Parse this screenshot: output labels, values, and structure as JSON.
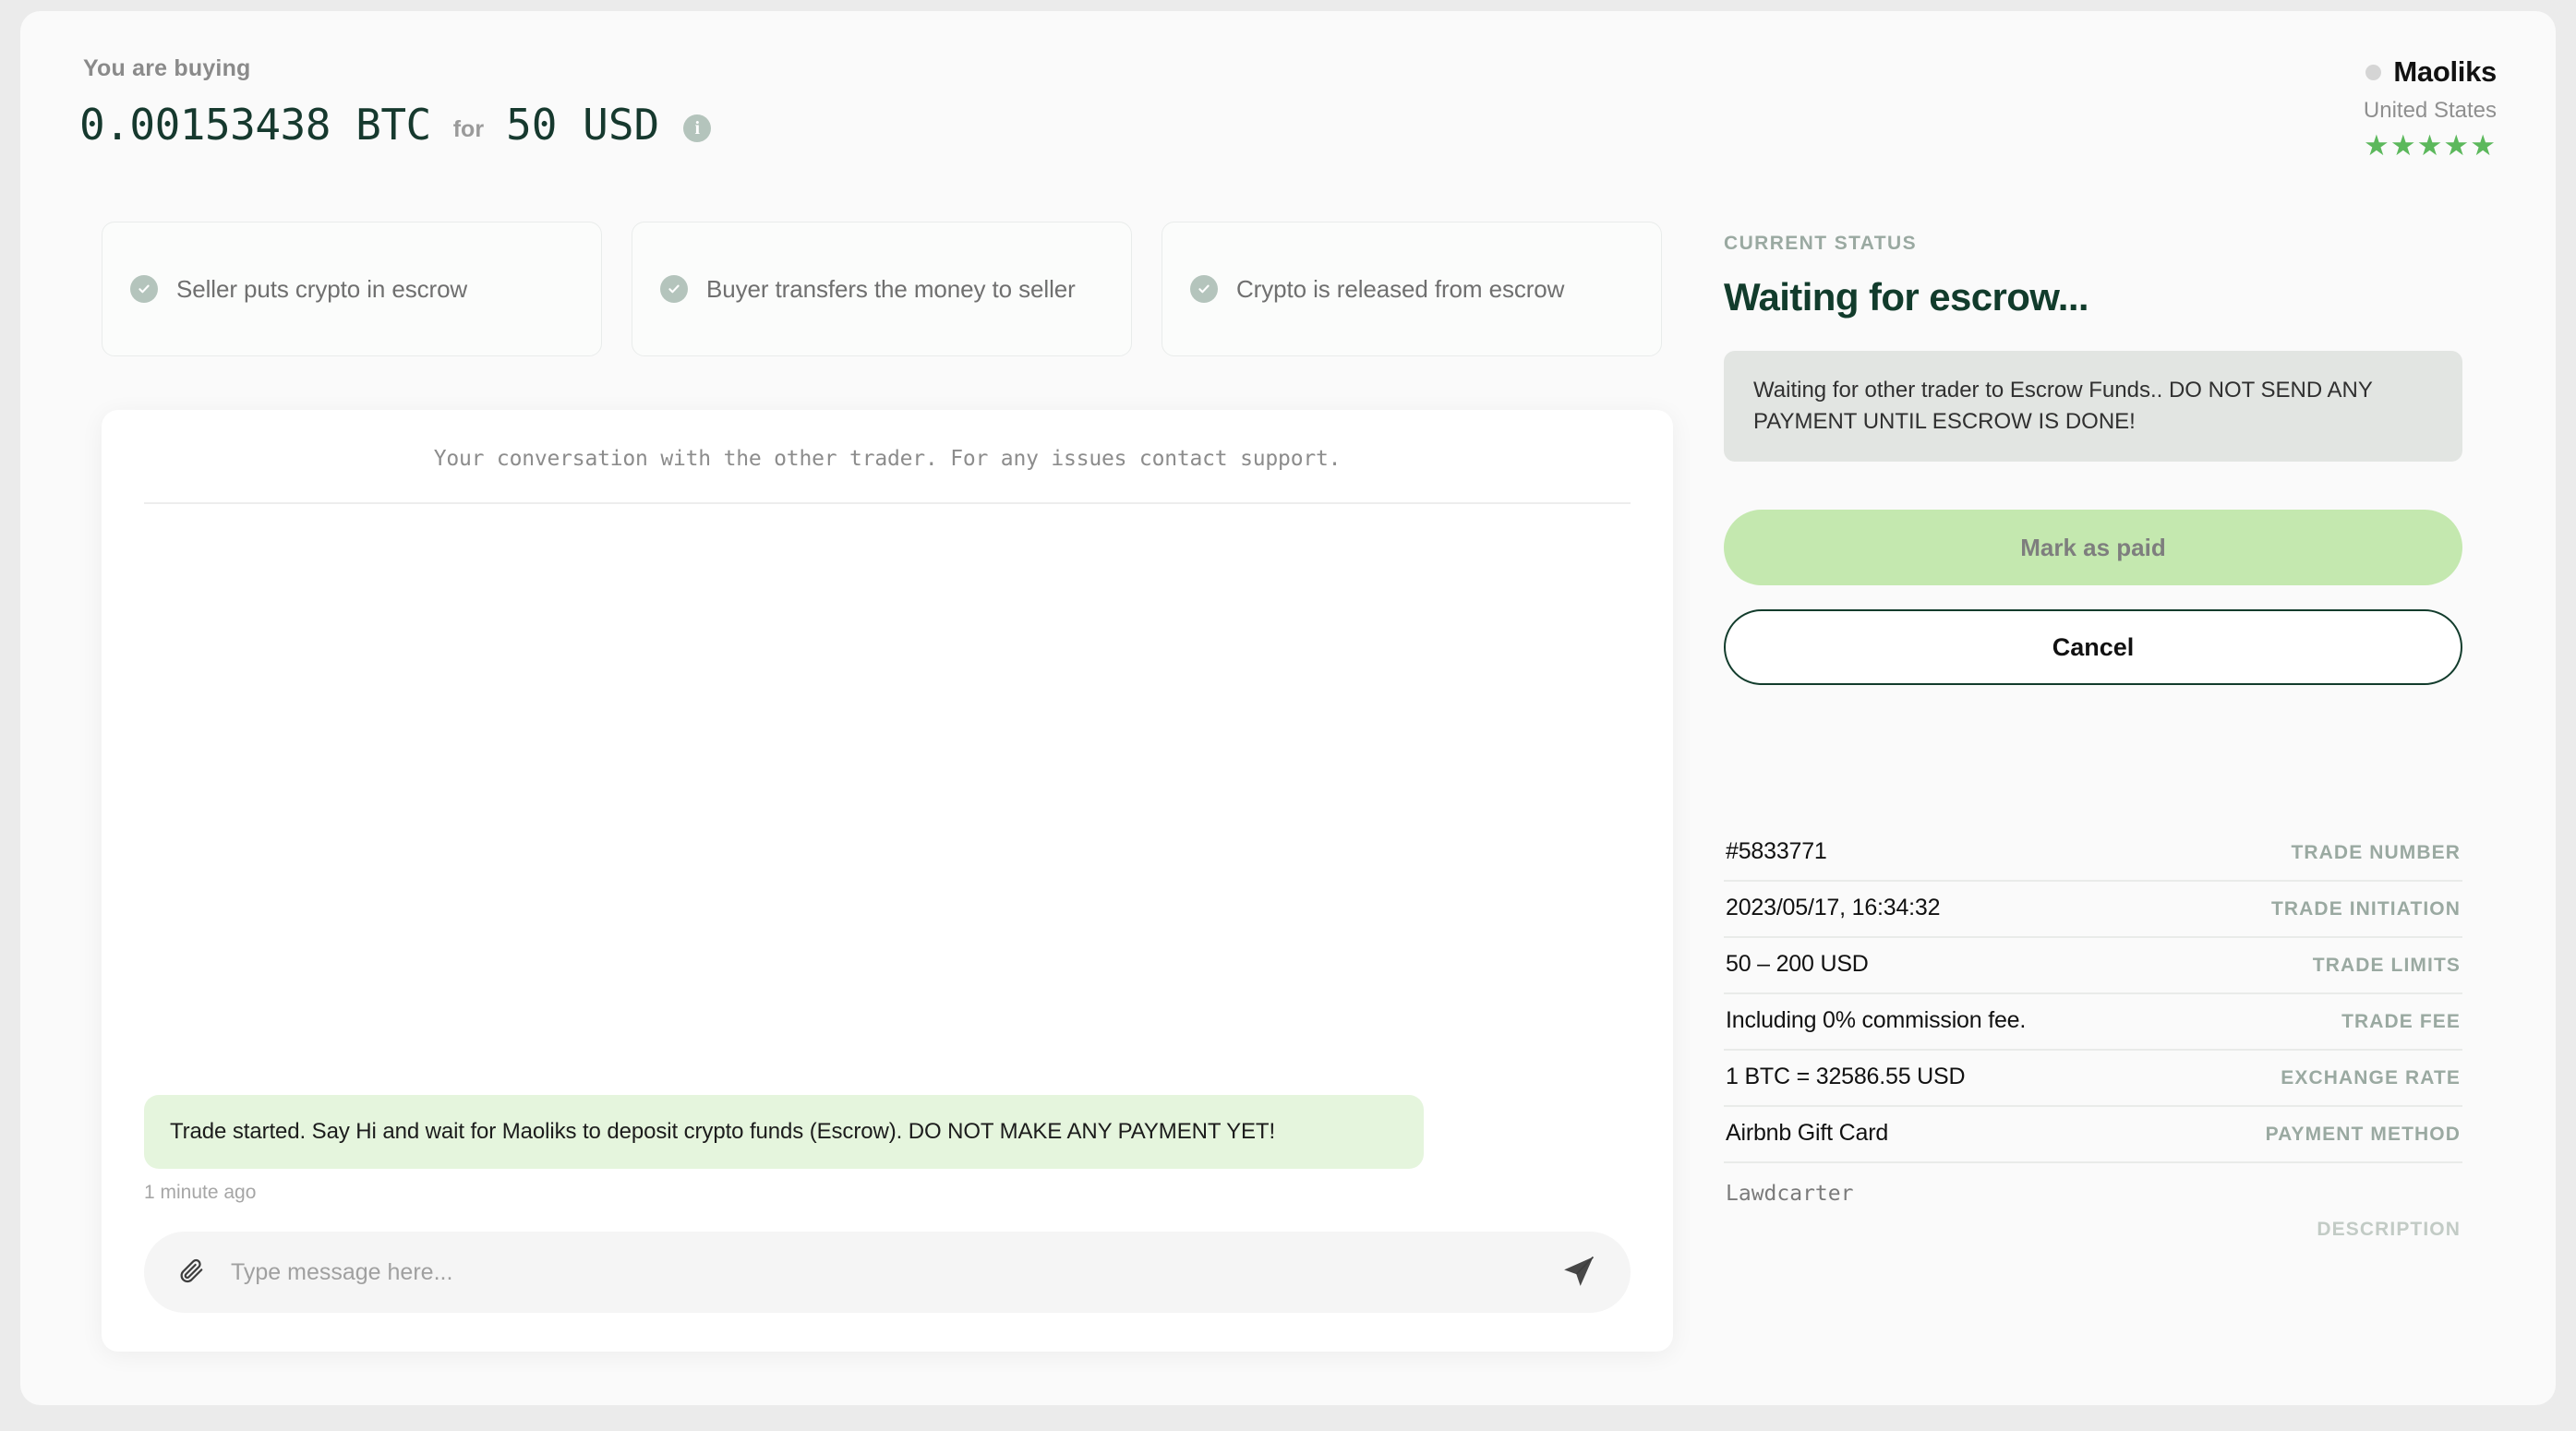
{
  "header": {
    "buying_label": "You are buying",
    "amount_crypto": "0.00153438 BTC",
    "for_label": "for",
    "amount_fiat": "50 USD",
    "info_icon_glyph": "i"
  },
  "seller": {
    "name": "Maoliks",
    "country": "United States",
    "stars": "★★★★★",
    "star_color": "#5cb85c",
    "status_dot_color": "#d5d5d5"
  },
  "steps": [
    {
      "label": "Seller puts crypto in escrow"
    },
    {
      "label": "Buyer transfers the money to seller"
    },
    {
      "label": "Crypto is released from escrow"
    }
  ],
  "chat": {
    "header": "Your conversation with the other trader. For any issues contact support.",
    "messages": [
      {
        "text": "Trade started. Say Hi and wait for Maoliks to deposit crypto funds (Escrow). DO NOT MAKE ANY PAYMENT YET!",
        "time": "1 minute ago"
      }
    ],
    "input_placeholder": "Type message here...",
    "input_value": "",
    "attach_icon": "paperclip-icon",
    "send_icon": "send-icon"
  },
  "status": {
    "label": "CURRENT STATUS",
    "title": "Waiting for escrow...",
    "alert": "Waiting for other trader to Escrow Funds.. DO NOT SEND ANY PAYMENT UNTIL ESCROW IS DONE!",
    "title_color": "#123c2c",
    "alert_bg": "#e2e5e2"
  },
  "actions": {
    "primary_label": "Mark as paid",
    "primary_bg": "#c4e8af",
    "secondary_label": "Cancel"
  },
  "details": [
    {
      "value": "#5833771",
      "label": "TRADE NUMBER"
    },
    {
      "value": "2023/05/17, 16:34:32",
      "label": "TRADE INITIATION"
    },
    {
      "value": "50 – 200 USD",
      "label": "TRADE LIMITS"
    },
    {
      "value": "Including 0% commission fee.",
      "label": "TRADE FEE"
    },
    {
      "value": "1 BTC = 32586.55 USD",
      "label": "EXCHANGE RATE"
    },
    {
      "value": "Airbnb Gift Card",
      "label": "PAYMENT METHOD"
    }
  ],
  "description": {
    "value": "Lawdcarter",
    "label": "DESCRIPTION"
  }
}
